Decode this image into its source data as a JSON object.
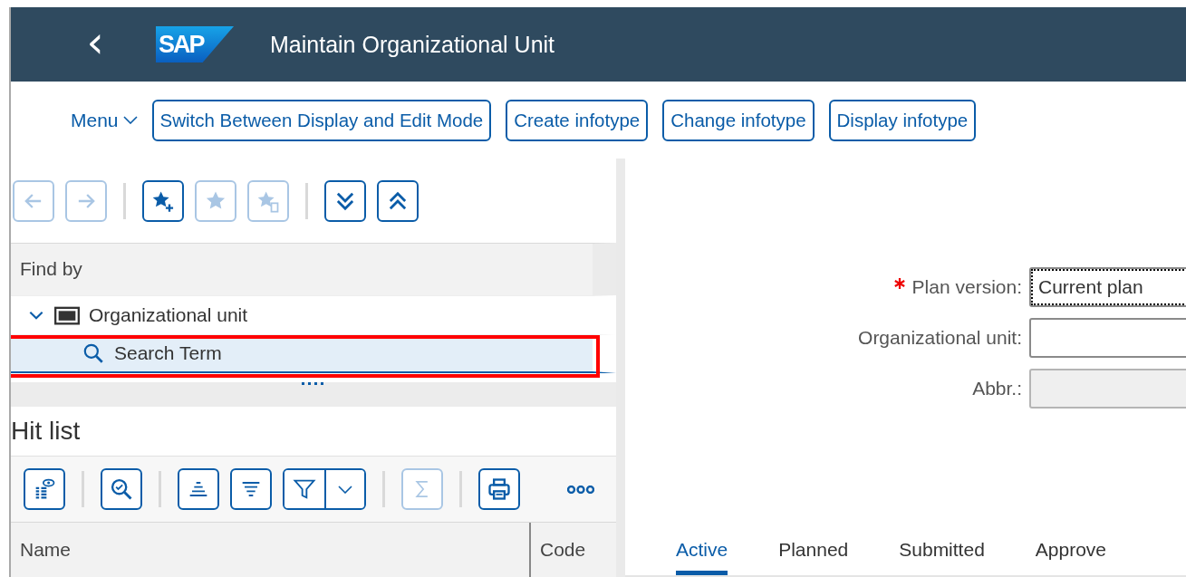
{
  "header": {
    "back": "‹",
    "logo": "SAP",
    "title": "Maintain Organizational Unit"
  },
  "toolbar": {
    "menu": "Menu",
    "buttons": [
      "Switch Between Display and Edit Mode",
      "Create infotype",
      "Change infotype",
      "Display infotype"
    ]
  },
  "nav_toolbar": [
    {
      "kind": "button",
      "disabled": true
    },
    {
      "kind": "button",
      "disabled": true
    },
    {
      "kind": "separator"
    },
    {
      "kind": "button",
      "disabled": false
    },
    {
      "kind": "button",
      "disabled": true
    },
    {
      "kind": "button",
      "disabled": true
    },
    {
      "kind": "separator"
    },
    {
      "kind": "button",
      "disabled": false
    },
    {
      "kind": "button",
      "disabled": false
    }
  ],
  "find_by": {
    "heading": "Find by",
    "tree": [
      {
        "label": "Organizational unit",
        "expanded": true,
        "selected": false,
        "children": [
          {
            "label": "Search Term",
            "selected": true,
            "highlighted": true
          }
        ]
      }
    ]
  },
  "hit_list": {
    "title": "Hit list",
    "toolbar": [
      {
        "kind": "button",
        "disabled": false
      },
      {
        "kind": "separator"
      },
      {
        "kind": "button",
        "disabled": false
      },
      {
        "kind": "separator"
      },
      {
        "kind": "button",
        "disabled": false
      },
      {
        "kind": "button",
        "disabled": false
      },
      {
        "kind": "split",
        "disabled": false
      },
      {
        "kind": "separator"
      },
      {
        "kind": "button",
        "disabled": true
      },
      {
        "kind": "separator"
      },
      {
        "kind": "button",
        "disabled": false
      },
      {
        "kind": "overflow",
        "disabled": false
      }
    ],
    "columns": [
      "Name",
      "Code"
    ]
  },
  "form": [
    {
      "label": "Plan version:",
      "required": true,
      "value": "Current plan",
      "focused": true,
      "disabled": false
    },
    {
      "label": "Organizational unit:",
      "required": false,
      "focused": false,
      "disabled": false
    },
    {
      "label": "Abbr.:",
      "required": false,
      "focused": false,
      "disabled": true
    }
  ],
  "tabs": [
    {
      "label": "Active",
      "selected": true
    },
    {
      "label": "Planned",
      "selected": false
    },
    {
      "label": "Submitted",
      "selected": false
    },
    {
      "label": "Approve",
      "selected": false
    }
  ]
}
